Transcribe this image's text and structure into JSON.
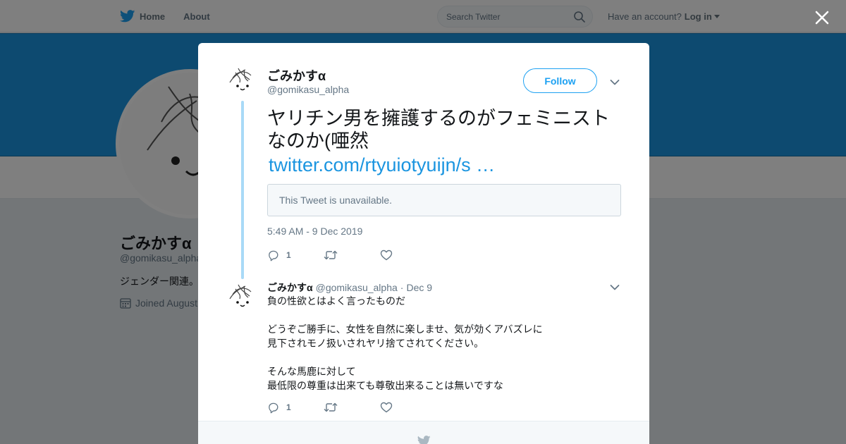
{
  "topbar": {
    "home_label": "Home",
    "about_label": "About",
    "search_placeholder": "Search Twitter",
    "account_prompt": "Have an account?",
    "login_label": "Log in"
  },
  "profile": {
    "name": "ごみかすα",
    "handle": "@gomikasu_alpha",
    "bio": "ジェンダー関連。",
    "joined": "Joined August"
  },
  "colors": {
    "brand": "#1da1f2",
    "banner": "#1b95e0",
    "thread_line": "#a9daf7",
    "muted": "#657786"
  },
  "modal": {
    "tweet": {
      "name": "ごみかすα",
      "handle": "@gomikasu_alpha",
      "follow_label": "Follow",
      "text": "ヤリチン男を擁護するのがフェミニストなのか(唖然",
      "link": "twitter.com/rtyuiotyuijn/s …",
      "quote_unavailable": "This Tweet is unavailable.",
      "timestamp": "5:49 AM - 9 Dec 2019",
      "reply_count": "1",
      "retweet_count": "",
      "like_count": ""
    },
    "reply": {
      "name": "ごみかすα",
      "handle": "@gomikasu_alpha",
      "separator": "·",
      "date": "Dec 9",
      "lines": [
        "負の性欲とはよく言ったものだ",
        "",
        "どうぞご勝手に、女性を自然に楽しませ、気が効くアバズレに",
        "見下されモノ扱いされヤリ捨てされてください。",
        "",
        "そんな馬鹿に対して",
        "最低限の尊重は出来ても尊敬出来ることは無いですな"
      ],
      "reply_count": "1",
      "retweet_count": "",
      "like_count": ""
    }
  },
  "icons": [
    "twitter-bird-icon",
    "search-icon",
    "calendar-icon",
    "close-icon",
    "chevron-down-icon",
    "reply-icon",
    "retweet-icon",
    "heart-icon"
  ]
}
